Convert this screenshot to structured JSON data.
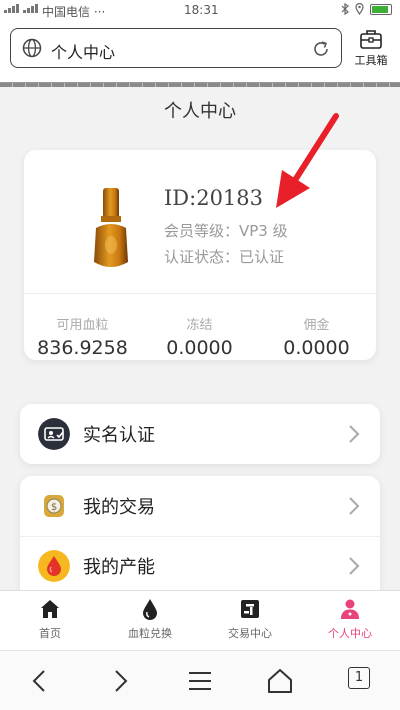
{
  "status_bar": {
    "carrier": "中国电信 ···",
    "time": "18:31"
  },
  "browser": {
    "url_text": "个人中心",
    "toolbox_label": "工具箱",
    "tab_count": "1"
  },
  "page": {
    "title": "个人中心"
  },
  "profile": {
    "id_text": "ID:20183",
    "level_text": "会员等级：VP3 级",
    "auth_text": "认证状态：已认证"
  },
  "stats": [
    {
      "label": "可用血粒",
      "value": "836.9258"
    },
    {
      "label": "冻结",
      "value": "0.0000"
    },
    {
      "label": "佣金",
      "value": "0.0000"
    }
  ],
  "menu": [
    {
      "label": "实名认证",
      "icon": "id-card-icon"
    },
    {
      "label": "我的交易",
      "icon": "coin-icon"
    },
    {
      "label": "我的产能",
      "icon": "blood-drop-icon"
    }
  ],
  "tabbar": [
    {
      "label": "首页",
      "icon": "home-icon"
    },
    {
      "label": "血粒兑换",
      "icon": "drop-icon"
    },
    {
      "label": "交易中心",
      "icon": "trade-icon"
    },
    {
      "label": "个人中心",
      "icon": "person-icon",
      "active": true
    }
  ],
  "colors": {
    "accent": "#e8437a",
    "arrow": "#e8202a"
  }
}
